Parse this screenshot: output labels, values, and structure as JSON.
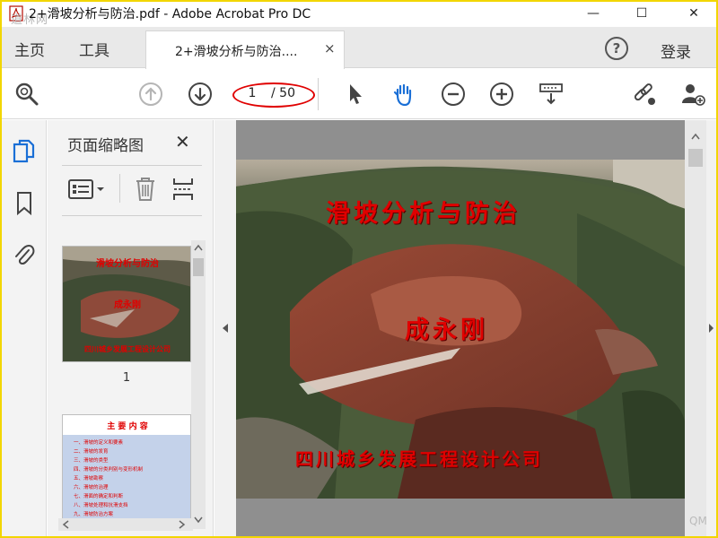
{
  "window": {
    "title": "2+滑坡分析与防治.pdf - Adobe Acrobat Pro DC",
    "watermark": "道林网",
    "minimize": "—",
    "maximize": "☐",
    "close": "✕"
  },
  "nav": {
    "home": "主页",
    "tools": "工具",
    "doc_tab_label": "2+滑坡分析与防治....",
    "doc_tab_close": "×",
    "help": "?",
    "sign_in": "登录"
  },
  "toolbar": {
    "page_current": "1",
    "page_total": "/ 50"
  },
  "thumbnails_panel": {
    "title": "页面缩略图",
    "close": "✕",
    "thumb_1_number": "1"
  },
  "slide": {
    "title": "滑坡分析与防治",
    "author": "成永刚",
    "company": "四川城乡发展工程设计公司"
  },
  "thumb2": {
    "heading": "主 要 内 容",
    "items": [
      "一、滑坡的定义和要素",
      "二、滑坡的发育",
      "三、滑坡的类型",
      "四、滑坡的分类判别与变形机制",
      "五、滑坡勘察",
      "六、滑坡的治理",
      "七、滑面的确定和判断",
      "八、滑坡处理和抗滑支挡",
      "九、滑坡防治方案"
    ]
  },
  "corner_mark": "QM",
  "colors": {
    "frame": "#f2d600",
    "tab_bar": "#e9e9e9",
    "page_highlight": "#e00000",
    "active_blue": "#1a6fd6",
    "doc_background": "#8f8f8f"
  },
  "icons": {
    "toolbar": [
      "search-icon",
      "page-up-icon",
      "page-down-icon",
      "select-pointer-icon",
      "hand-tool-icon",
      "zoom-out-icon",
      "zoom-in-icon",
      "scroll-mode-icon",
      "share-link-icon",
      "add-user-icon"
    ],
    "rail": [
      "page-thumbnails-icon",
      "bookmarks-icon",
      "attachments-icon"
    ],
    "panel": [
      "thumbnail-options-icon",
      "delete-page-icon",
      "insert-page-icon"
    ]
  }
}
